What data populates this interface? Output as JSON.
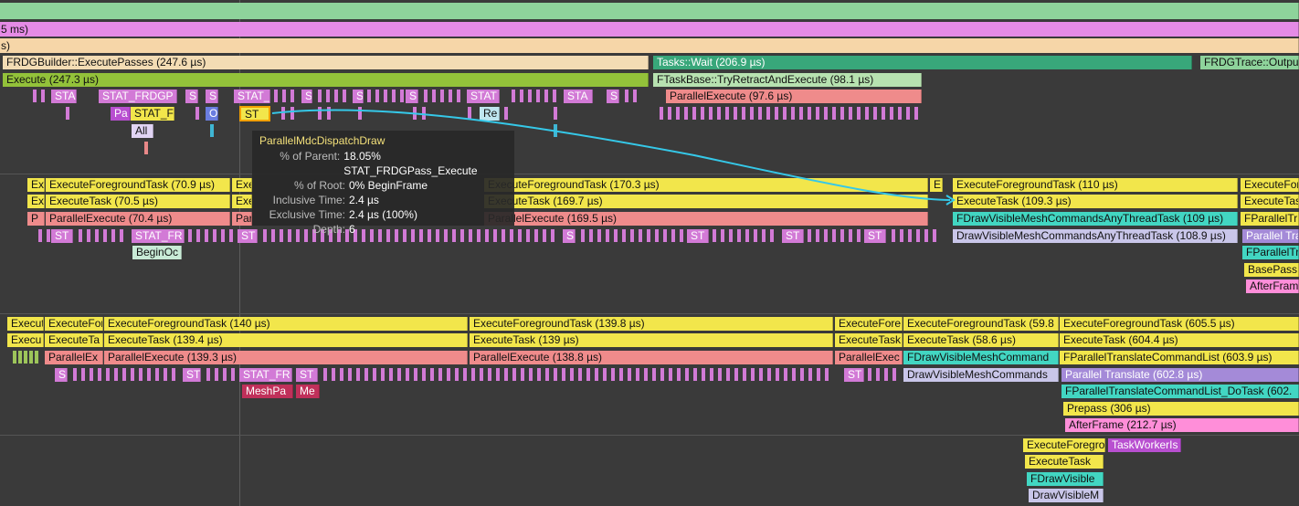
{
  "top": {
    "bar1": "",
    "bar2": "5 ms)",
    "bar3": "s)"
  },
  "lane1": {
    "row1": [
      "FRDGBuilder::ExecutePasses (247.6 µs)",
      "Tasks::Wait (206.9 µs)",
      "FRDGTrace::Output"
    ],
    "row2": [
      "Execute (247.3 µs)",
      "FTaskBase::TryRetractAndExecute (98.1 µs)"
    ],
    "row3": [
      "STA",
      "STAT_FRDGP",
      "S",
      "S",
      "STAT_",
      "S",
      "S",
      "S",
      "STAT",
      "STA",
      "S",
      "ParallelExecute (97.6 µs)"
    ],
    "row4": [
      "Pa",
      "STAT_F",
      "O",
      "ST",
      "Re"
    ],
    "row5": [
      "All"
    ]
  },
  "tooltip": {
    "title": "ParallelMdcDispatchDraw",
    "rows": [
      {
        "k": "% of Parent:",
        "v": "18.05% STAT_FRDGPass_Execute"
      },
      {
        "k": "% of Root:",
        "v": "0% BeginFrame"
      },
      {
        "k": "Inclusive Time:",
        "v": "2.4 µs"
      },
      {
        "k": "Exclusive Time:",
        "v": "2.4 µs (100%)"
      },
      {
        "k": "Depth:",
        "v": "6"
      }
    ]
  },
  "lane2": {
    "row1": [
      "Ex",
      "ExecuteForegroundTask (70.9 µs)",
      "Exe",
      "ExecuteForegroundTask (170.3 µs)",
      "E",
      "ExecuteForegroundTask (110 µs)",
      "ExecuteFor"
    ],
    "row2": [
      "Ex",
      "ExecuteTask (70.5 µs)",
      "Exe",
      "ExecuteTask (169.7 µs)",
      "ExecuteTask (109.3 µs)",
      "ExecuteTas"
    ],
    "row3": [
      "P",
      "ParallelExecute (70.4 µs)",
      "Par",
      "ParallelExecute (169.5 µs)",
      "FDrawVisibleMeshCommandsAnyThreadTask (109 µs)",
      "FParallelTr"
    ],
    "row4": [
      "ST",
      "STAT_FR",
      "ST",
      "S",
      "ST",
      "ST",
      "ST",
      "DrawVisibleMeshCommandsAnyThreadTask (108.9 µs)",
      "Parallel Tra"
    ],
    "row5": [
      "BeginOc",
      "FParallelTr"
    ],
    "row6": [
      "BasePass"
    ],
    "row7": [
      "AfterFram"
    ]
  },
  "lane3": {
    "row1": [
      "Execut",
      "ExecuteFor",
      "ExecuteForegroundTask (140 µs)",
      "ExecuteForegroundTask (139.8 µs)",
      "ExecuteFore",
      "ExecuteForegroundTask (59.8",
      "ExecuteForegroundTask (605.5 µs)"
    ],
    "row2": [
      "Execu",
      "ExecuteTa",
      "ExecuteTask (139.4 µs)",
      "ExecuteTask (139 µs)",
      "ExecuteTask",
      "ExecuteTask (58.6 µs)",
      "ExecuteTask (604.4 µs)"
    ],
    "row3": [
      "ParallelEx",
      "ParallelExecute (139.3 µs)",
      "ParallelExecute (138.8 µs)",
      "ParallelExec",
      "FDrawVisibleMeshCommand",
      "FParallelTranslateCommandList (603.9 µs)"
    ],
    "row4": [
      "S",
      "ST",
      "STAT_FR",
      "ST",
      "ST",
      "DrawVisibleMeshCommands",
      "Parallel Translate (602.8 µs)"
    ],
    "row5": [
      "MeshPa",
      "Me",
      "FParallelTranslateCommandList_DoTask (602."
    ],
    "row6": [
      "Prepass (306 µs)"
    ],
    "row7": [
      "AfterFrame (212.7 µs)"
    ]
  },
  "lane4": {
    "row1": [
      "ExecuteForegro",
      "TaskWorkerIs"
    ],
    "row2": [
      "ExecuteTask"
    ],
    "row3": [
      "FDrawVisible"
    ],
    "row4": [
      "DrawVisibleM"
    ]
  },
  "colors": {
    "green": "#8ed39b",
    "magenta": "#e58be6",
    "peach": "#f6d6a8",
    "tan": "#f3dcb4",
    "lime": "#93c23a",
    "teal": "#38a77a",
    "yellow": "#f2e64b",
    "salmon": "#ef8b8b",
    "pink": "#d27ad6",
    "cyan": "#42d6c2",
    "lavender": "#c9c6e9",
    "purple": "#a48ad8"
  }
}
